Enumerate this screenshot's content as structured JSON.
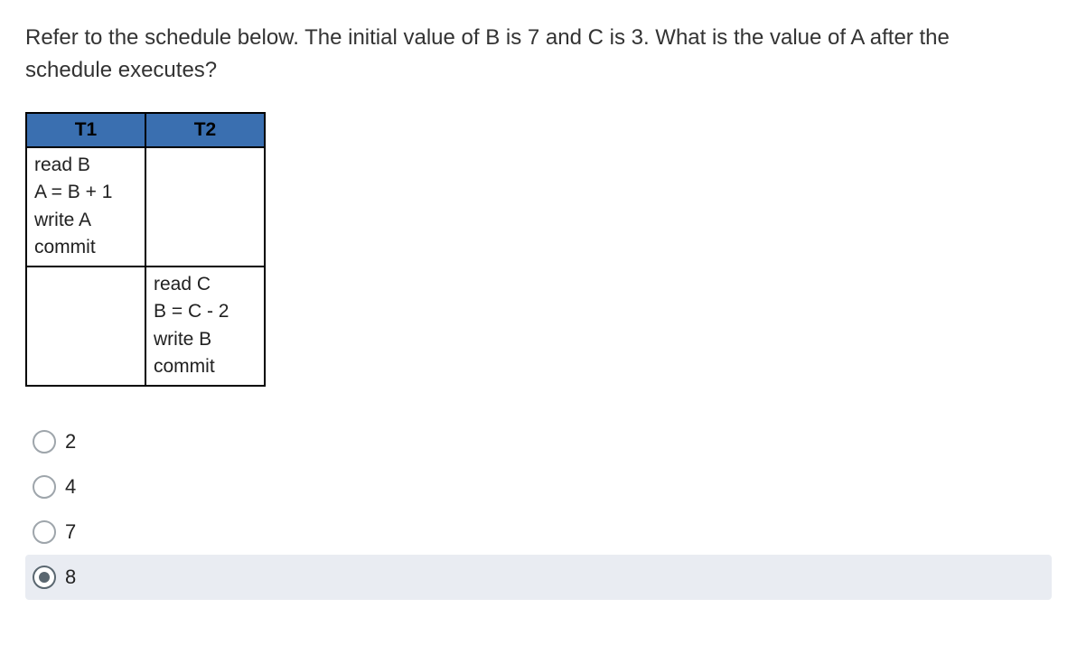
{
  "question": "Refer to the schedule below. The initial value of B is 7 and C is 3. What is the value of A after the schedule executes?",
  "schedule": {
    "headers": [
      "T1",
      "T2"
    ],
    "rows": [
      {
        "t1": [
          "read B",
          "A = B + 1",
          "write A",
          "commit"
        ],
        "t2": []
      },
      {
        "t1": [],
        "t2": [
          "read C",
          "B = C - 2",
          "write B",
          "commit"
        ]
      }
    ]
  },
  "options": [
    {
      "label": "2",
      "selected": false
    },
    {
      "label": "4",
      "selected": false
    },
    {
      "label": "7",
      "selected": false
    },
    {
      "label": "8",
      "selected": true
    }
  ]
}
